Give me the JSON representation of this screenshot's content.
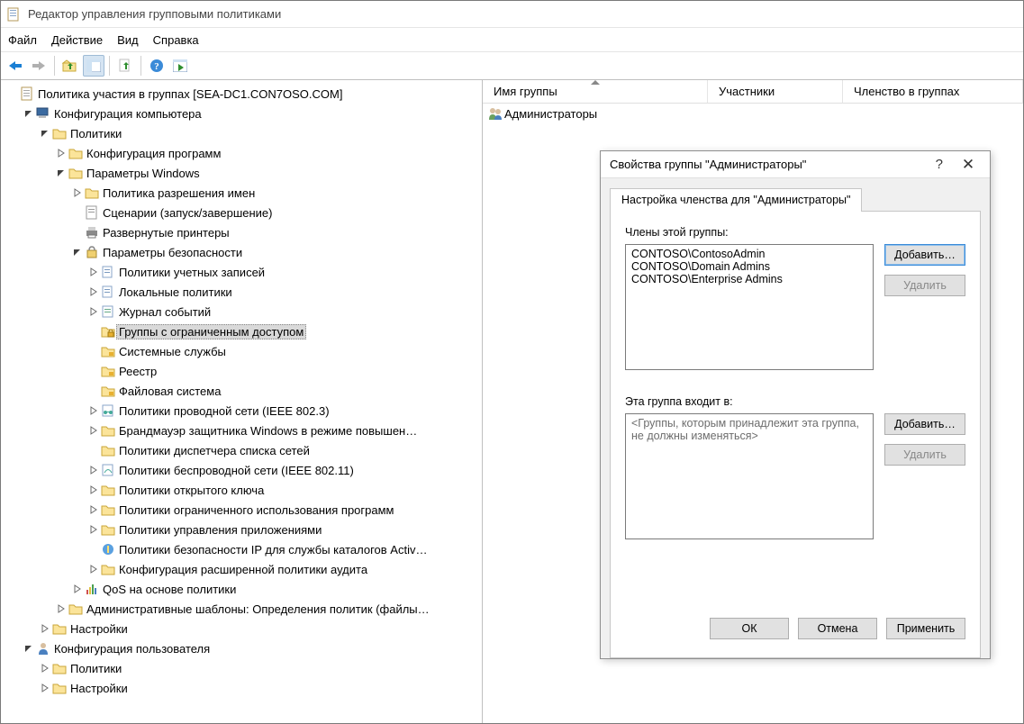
{
  "app_title": "Редактор управления групповыми политиками",
  "menubar": {
    "file": "Файл",
    "action": "Действие",
    "view": "Вид",
    "help": "Справка"
  },
  "toolbar": {
    "back": "back",
    "forward": "forward",
    "up": "up-folder",
    "detail": "detail-view",
    "export": "export-list",
    "help": "help",
    "refresh-item": "refresh-item"
  },
  "tree": {
    "root": "Политика участия в группах [SEA-DC1.CON7OSO.COM]",
    "computer_cfg": "Конфигурация компьютера",
    "policies": "Политики",
    "software_policies": "Конфигурация программ",
    "windows_settings": "Параметры Windows",
    "name_resolution": "Политика разрешения имен",
    "scripts": "Сценарии (запуск/завершение)",
    "deployed_printers": "Развернутые принтеры",
    "security_settings": "Параметры безопасности",
    "account_policies": "Политики учетных записей",
    "local_policies": "Локальные политики",
    "event_log": "Журнал событий",
    "restricted_groups": "Группы с ограниченным доступом",
    "system_services": "Системные службы",
    "registry": "Реестр",
    "file_system": "Файловая система",
    "wired": "Политики проводной сети (IEEE 802.3)",
    "defender_fw": "Брандмауэр защитника Windows в режиме повышен…",
    "network_list": "Политики диспетчера списка сетей",
    "wireless": "Политики беспроводной сети (IEEE 802.11)",
    "pubkey": "Политики открытого ключа",
    "srp": "Политики ограниченного использования программ",
    "app_control": "Политики управления приложениями",
    "ipsec": "Политики безопасности IP для службы каталогов Activ…",
    "audit": "Конфигурация расширенной политики аудита",
    "qos": "QoS на основе политики",
    "admin_templates": "Административные шаблоны: Определения политик (файлы…",
    "settings1": "Настройки",
    "user_cfg": "Конфигурация пользователя",
    "policies2": "Политики",
    "settings2": "Настройки"
  },
  "list": {
    "col_group_name": "Имя группы",
    "col_members": "Участники",
    "col_member_of": "Членство в группах",
    "row0_name": "Администраторы"
  },
  "dialog": {
    "title": "Свойства группы \"Администраторы\"",
    "tab_label": "Настройка членства для \"Администраторы\"",
    "members_label": "Члены этой группы:",
    "members": {
      "0": "CONTOSO\\ContosoAdmin",
      "1": "CONTOSO\\Domain Admins",
      "2": "CONTOSO\\Enterprise Admins"
    },
    "memberof_label": "Эта группа входит в:",
    "memberof_placeholder": "<Группы, которым принадлежит эта группа, не должны изменяться>",
    "add": "Добавить…",
    "remove": "Удалить",
    "ok": "ОК",
    "cancel": "Отмена",
    "apply": "Применить"
  }
}
